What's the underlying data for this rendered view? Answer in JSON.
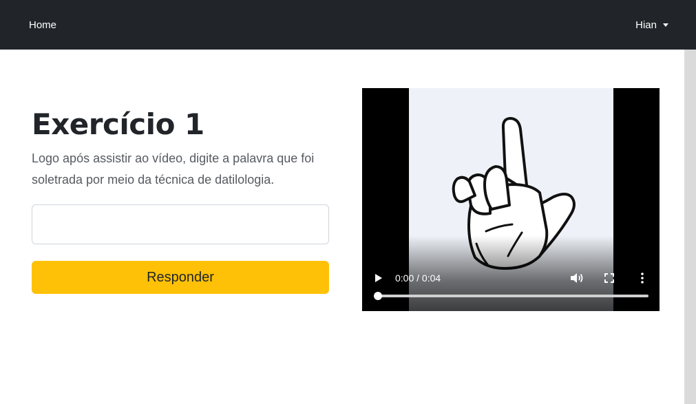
{
  "navbar": {
    "home_label": "Home",
    "user_label": "Hian"
  },
  "exercise": {
    "title": "Exercício 1",
    "description": "Logo após assistir ao vídeo, digite a palavra que foi soletrada por meio da técnica de datilologia.",
    "answer_value": "",
    "submit_label": "Responder"
  },
  "video": {
    "time_display": "0:00 / 0:04",
    "progress": 0.0
  },
  "colors": {
    "navbar_bg": "#212529",
    "button_accent": "#ffc107",
    "video_frame_bg": "#eef2f8"
  },
  "icons": [
    "chevron-down-icon",
    "play-icon",
    "volume-icon",
    "fullscreen-icon",
    "more-vert-icon"
  ]
}
